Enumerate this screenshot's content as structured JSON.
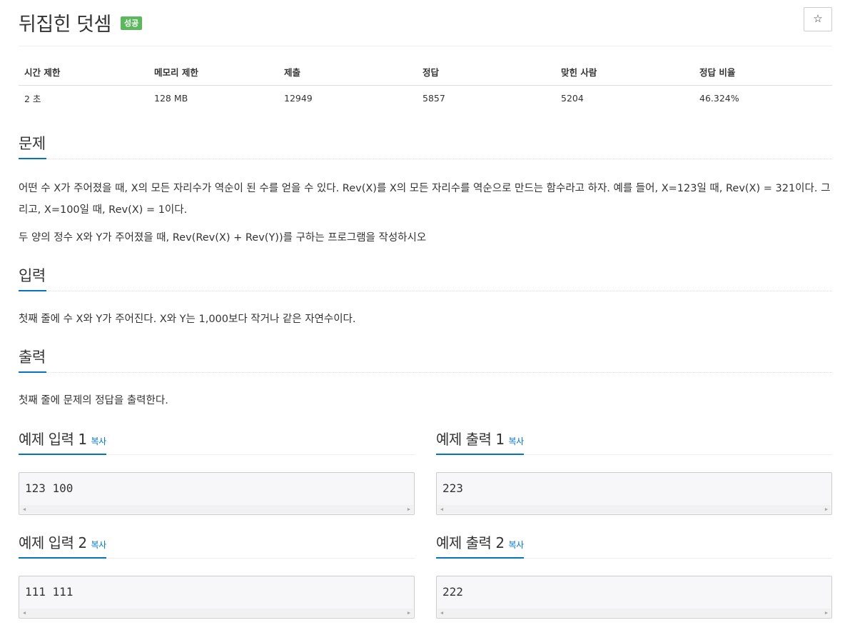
{
  "problem": {
    "title": "뒤집힌 덧셈",
    "status_badge": "성공",
    "star_icon": "☆"
  },
  "info_table": {
    "headers": [
      "시간 제한",
      "메모리 제한",
      "제출",
      "정답",
      "맞힌 사람",
      "정답 비율"
    ],
    "values": [
      "2 초",
      "128 MB",
      "12949",
      "5857",
      "5204",
      "46.324%"
    ]
  },
  "sections": {
    "problem": {
      "heading": "문제",
      "paragraphs": [
        "어떤 수 X가 주어졌을 때, X의 모든 자리수가 역순이 된 수를 얻을 수 있다. Rev(X)를 X의 모든 자리수를 역순으로 만드는 함수라고 하자. 예를 들어, X=123일 때, Rev(X) = 321이다. 그리고, X=100일 때, Rev(X) = 1이다.",
        "두 양의 정수 X와 Y가 주어졌을 때, Rev(Rev(X) + Rev(Y))를 구하는 프로그램을 작성하시오"
      ]
    },
    "input": {
      "heading": "입력",
      "text": "첫째 줄에 수 X와 Y가 주어진다. X와 Y는 1,000보다 작거나 같은 자연수이다."
    },
    "output": {
      "heading": "출력",
      "text": "첫째 줄에 문제의 정답을 출력한다."
    }
  },
  "samples": [
    {
      "title": "예제 입력 1",
      "copy_label": "복사",
      "content": "123 100"
    },
    {
      "title": "예제 출력 1",
      "copy_label": "복사",
      "content": "223"
    },
    {
      "title": "예제 입력 2",
      "copy_label": "복사",
      "content": "111 111"
    },
    {
      "title": "예제 출력 2",
      "copy_label": "복사",
      "content": "222"
    }
  ],
  "scroll_arrows": {
    "left": "◀",
    "right": "▶"
  }
}
